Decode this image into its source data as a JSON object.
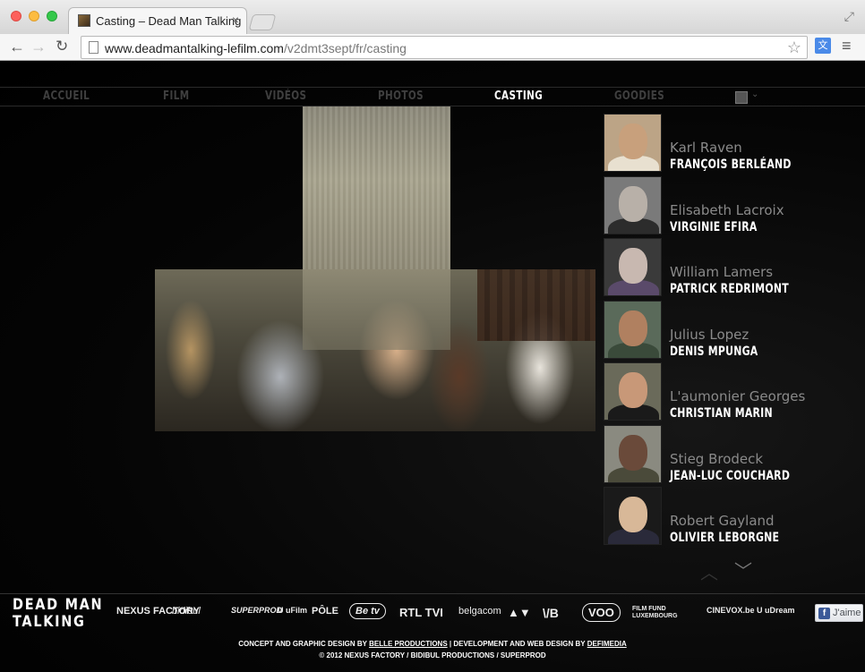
{
  "browser": {
    "tab_title": "Casting – Dead Man Talking",
    "tab_close": "×",
    "url_host": "www.deadmantalking-lefilm.com",
    "url_path": "/v2dmt3sept/fr/casting"
  },
  "nav": {
    "items": [
      "ACCUEIL",
      "FILM",
      "VIDÉOS",
      "PHOTOS",
      "CASTING",
      "GOODIES"
    ],
    "active": "CASTING"
  },
  "cast": [
    {
      "role": "Karl Raven",
      "actor": "FRANÇOIS BERLÉAND",
      "skin": "#c8a07c",
      "clothes": "#e8e0d0",
      "bg": "#bca486"
    },
    {
      "role": "Elisabeth Lacroix",
      "actor": "VIRGINIE EFIRA",
      "skin": "#b8b0a8",
      "clothes": "#2c2c2c",
      "bg": "#7a7a7a"
    },
    {
      "role": "William Lamers",
      "actor": "PATRICK REDRIMONT",
      "skin": "#c8b8b0",
      "clothes": "#5a4a6a",
      "bg": "#3a3a3a"
    },
    {
      "role": "Julius Lopez",
      "actor": "DENIS MPUNGA",
      "skin": "#b08060",
      "clothes": "#3a4a3a",
      "bg": "#5a6a5a"
    },
    {
      "role": "L'aumonier Georges",
      "actor": "CHRISTIAN MARIN",
      "skin": "#c89878",
      "clothes": "#1a1a1a",
      "bg": "#6a6a5a"
    },
    {
      "role": "Stieg Brodeck",
      "actor": "JEAN-LUC COUCHARD",
      "skin": "#6a4a3a",
      "clothes": "#4a4a3a",
      "bg": "#8a8a80"
    },
    {
      "role": "Robert Gayland",
      "actor": "OLIVIER LEBORGNE",
      "skin": "#d8b898",
      "clothes": "#2a2a3a",
      "bg": "#1a1a1a"
    }
  ],
  "footer": {
    "logo_line1": "DEAD MAN",
    "logo_line2": "TALKING",
    "partners": [
      {
        "name": "NEXUS FACTORY",
        "icon": "nexus-factory-logo"
      },
      {
        "name": "bidibul",
        "icon": "bidibul-logo"
      },
      {
        "name": "SUPERPROD",
        "icon": "superprod-logo"
      },
      {
        "name": "U uFilm",
        "icon": "ufilm-logo"
      },
      {
        "name": "PÔLE",
        "icon": "pole-logo"
      },
      {
        "name": "Be tv",
        "icon": "betv-logo"
      },
      {
        "name": "RTL TVI",
        "icon": "rtltvi-logo"
      },
      {
        "name": "belgacom",
        "icon": "belgacom-logo"
      },
      {
        "name": "▲▼",
        "icon": "wallonia-logo"
      },
      {
        "name": "\\/B",
        "icon": "federation-wb-logo"
      },
      {
        "name": "VOO",
        "icon": "voo-logo"
      },
      {
        "name": "FILM FUND LUXEMBOURG",
        "icon": "film-fund-luxembourg-logo"
      },
      {
        "name": "CINEVOX.be",
        "icon": "cinevox-logo"
      },
      {
        "name": "U uDream",
        "icon": "udream-logo"
      }
    ],
    "fb_icon": "f",
    "fb_label": "J'aime",
    "credits_1_prefix": "CONCEPT AND GRAPHIC DESIGN BY",
    "credits_1_link1": "BELLE PRODUCTIONS",
    "credits_1_mid": "| DEVELOPMENT AND WEB DESIGN BY",
    "credits_1_link2": "DEFIMEDIA",
    "credits_2": "© 2012 NEXUS FACTORY / BIDIBUL PRODUCTIONS / SUPERPROD"
  }
}
